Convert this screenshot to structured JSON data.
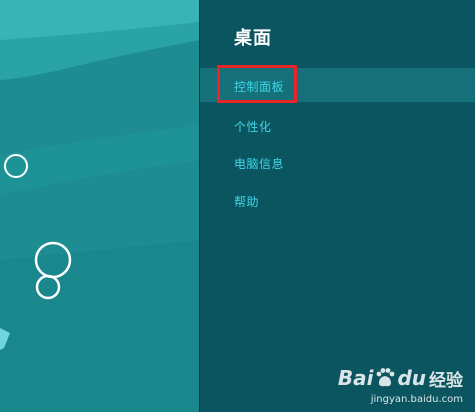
{
  "settings_pane": {
    "title": "桌面",
    "items": [
      {
        "label": "控制面板",
        "highlighted": true
      },
      {
        "label": "个性化",
        "highlighted": false
      },
      {
        "label": "电脑信息",
        "highlighted": false
      },
      {
        "label": "帮助",
        "highlighted": false
      }
    ]
  },
  "watermark": {
    "logo_text_1": "Bai",
    "logo_text_2": "du",
    "logo_text_3": "经验",
    "url": "jingyan.baidu.com"
  },
  "colors": {
    "desktop_background": "#1d8d92",
    "pane_background": "#0b5560",
    "menu_text": "#3fd6e6",
    "highlight_border": "#e8262a"
  },
  "icons": [
    "bubble-icon",
    "paw-icon"
  ]
}
